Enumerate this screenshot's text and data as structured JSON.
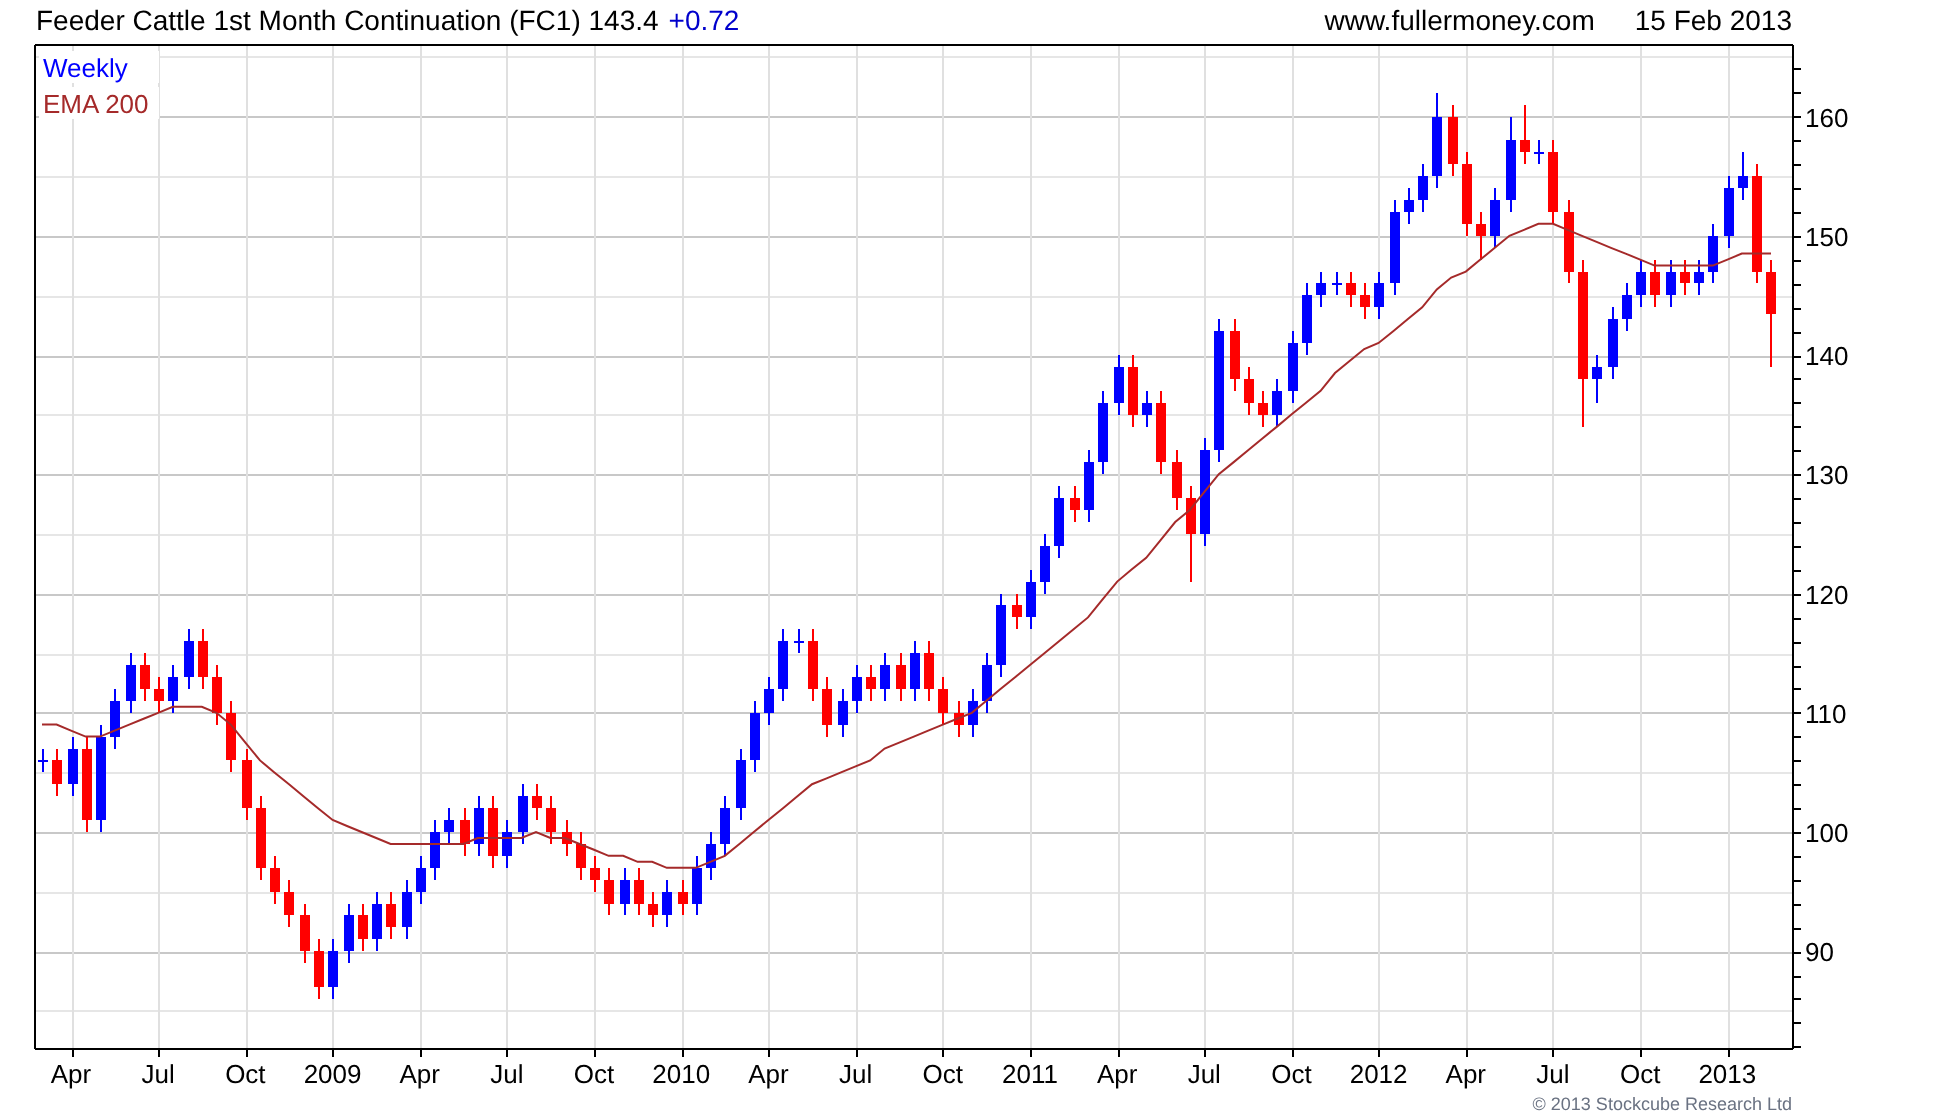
{
  "header": {
    "title": "Feeder Cattle 1st Month Continuation (FC1) 143.4",
    "change": "+0.72",
    "site": "www.fullermoney.com",
    "date": "15 Feb 2013"
  },
  "chart": {
    "legend": [
      {
        "label": "Weekly",
        "color": "#0000ff"
      }
    ],
    "chart_data": {
      "type": "candlestick",
      "grid": true,
      "categories": [
        null,
        null,
        "Apr",
        null,
        null,
        null,
        null,
        null,
        "Jul",
        null,
        null,
        null,
        null,
        null,
        "Oct",
        null,
        null,
        null,
        null,
        null,
        "2009",
        null,
        null,
        null,
        null,
        null,
        "Apr",
        null,
        null,
        null,
        null,
        null,
        "Jul",
        null,
        null,
        null,
        null,
        null,
        "Oct",
        null,
        null,
        null,
        null,
        null,
        "2010",
        null,
        null,
        null,
        null,
        null,
        "Apr",
        null,
        null,
        null,
        null,
        null,
        "Jul",
        null,
        null,
        null,
        null,
        null,
        "Oct",
        null,
        null,
        null,
        null,
        null,
        "2011",
        null,
        null,
        null,
        null,
        null,
        "Apr",
        null,
        null,
        null,
        null,
        null,
        "Jul",
        null,
        null,
        null,
        null,
        null,
        "Oct",
        null,
        null,
        null,
        null,
        null,
        "2012",
        null,
        null,
        null,
        null,
        null,
        "Apr",
        null,
        null,
        null,
        null,
        null,
        "Jul",
        null,
        null,
        null,
        null,
        null,
        "Oct",
        null,
        null,
        null,
        null,
        null,
        "2013",
        null,
        null,
        null
      ],
      "ohlc": [
        [
          106,
          107,
          105,
          106
        ],
        [
          106,
          107,
          103,
          104
        ],
        [
          104,
          108,
          103,
          107
        ],
        [
          107,
          108,
          100,
          101
        ],
        [
          101,
          109,
          100,
          108
        ],
        [
          108,
          112,
          107,
          111
        ],
        [
          111,
          115,
          110,
          114
        ],
        [
          114,
          115,
          111,
          112
        ],
        [
          112,
          113,
          110,
          111
        ],
        [
          111,
          114,
          110,
          113
        ],
        [
          113,
          117,
          112,
          116
        ],
        [
          116,
          117,
          112,
          113
        ],
        [
          113,
          114,
          109,
          110
        ],
        [
          110,
          111,
          105,
          106
        ],
        [
          106,
          107,
          101,
          102
        ],
        [
          102,
          103,
          96,
          97
        ],
        [
          97,
          98,
          94,
          95
        ],
        [
          95,
          96,
          92,
          93
        ],
        [
          93,
          94,
          89,
          90
        ],
        [
          90,
          91,
          86,
          87
        ],
        [
          87,
          91,
          86,
          90
        ],
        [
          90,
          94,
          89,
          93
        ],
        [
          93,
          94,
          90,
          91
        ],
        [
          91,
          95,
          90,
          94
        ],
        [
          94,
          95,
          91,
          92
        ],
        [
          92,
          96,
          91,
          95
        ],
        [
          95,
          98,
          94,
          97
        ],
        [
          97,
          101,
          96,
          100
        ],
        [
          100,
          102,
          99,
          101
        ],
        [
          101,
          102,
          98,
          99
        ],
        [
          99,
          103,
          98,
          102
        ],
        [
          102,
          103,
          97,
          98
        ],
        [
          98,
          101,
          97,
          100
        ],
        [
          100,
          104,
          99,
          103
        ],
        [
          103,
          104,
          101,
          102
        ],
        [
          102,
          103,
          99,
          100
        ],
        [
          100,
          101,
          98,
          99
        ],
        [
          99,
          100,
          96,
          97
        ],
        [
          97,
          98,
          95,
          96
        ],
        [
          96,
          97,
          93,
          94
        ],
        [
          94,
          97,
          93,
          96
        ],
        [
          96,
          97,
          93,
          94
        ],
        [
          94,
          95,
          92,
          93
        ],
        [
          93,
          96,
          92,
          95
        ],
        [
          95,
          96,
          93,
          94
        ],
        [
          94,
          98,
          93,
          97
        ],
        [
          97,
          100,
          96,
          99
        ],
        [
          99,
          103,
          98,
          102
        ],
        [
          102,
          107,
          101,
          106
        ],
        [
          106,
          111,
          105,
          110
        ],
        [
          110,
          113,
          109,
          112
        ],
        [
          112,
          117,
          111,
          116
        ],
        [
          116,
          117,
          115,
          116
        ],
        [
          116,
          117,
          111,
          112
        ],
        [
          112,
          113,
          108,
          109
        ],
        [
          109,
          112,
          108,
          111
        ],
        [
          111,
          114,
          110,
          113
        ],
        [
          113,
          114,
          111,
          112
        ],
        [
          112,
          115,
          111,
          114
        ],
        [
          114,
          115,
          111,
          112
        ],
        [
          112,
          116,
          111,
          115
        ],
        [
          115,
          116,
          111,
          112
        ],
        [
          112,
          113,
          109,
          110
        ],
        [
          110,
          111,
          108,
          109
        ],
        [
          109,
          112,
          108,
          111
        ],
        [
          111,
          115,
          110,
          114
        ],
        [
          114,
          120,
          113,
          119
        ],
        [
          119,
          120,
          117,
          118
        ],
        [
          118,
          122,
          117,
          121
        ],
        [
          121,
          125,
          120,
          124
        ],
        [
          124,
          129,
          123,
          128
        ],
        [
          128,
          129,
          126,
          127
        ],
        [
          127,
          132,
          126,
          131
        ],
        [
          131,
          137,
          130,
          136
        ],
        [
          136,
          140,
          135,
          139
        ],
        [
          139,
          140,
          134,
          135
        ],
        [
          135,
          137,
          134,
          136
        ],
        [
          136,
          137,
          130,
          131
        ],
        [
          131,
          132,
          127,
          128
        ],
        [
          128,
          129,
          121,
          125
        ],
        [
          125,
          133,
          124,
          132
        ],
        [
          132,
          143,
          131,
          142
        ],
        [
          142,
          143,
          137,
          138
        ],
        [
          138,
          139,
          135,
          136
        ],
        [
          136,
          137,
          134,
          135
        ],
        [
          135,
          138,
          134,
          137
        ],
        [
          137,
          142,
          136,
          141
        ],
        [
          141,
          146,
          140,
          145
        ],
        [
          145,
          147,
          144,
          146
        ],
        [
          146,
          147,
          145,
          146
        ],
        [
          146,
          147,
          144,
          145
        ],
        [
          145,
          146,
          143,
          144
        ],
        [
          144,
          147,
          143,
          146
        ],
        [
          146,
          153,
          145,
          152
        ],
        [
          152,
          154,
          151,
          153
        ],
        [
          153,
          156,
          152,
          155
        ],
        [
          155,
          162,
          154,
          160
        ],
        [
          160,
          161,
          155,
          156
        ],
        [
          156,
          157,
          150,
          151
        ],
        [
          151,
          152,
          148,
          150
        ],
        [
          150,
          154,
          149,
          153
        ],
        [
          153,
          160,
          152,
          158
        ],
        [
          158,
          161,
          156,
          157
        ],
        [
          157,
          158,
          156,
          157
        ],
        [
          157,
          158,
          151,
          152
        ],
        [
          152,
          153,
          146,
          147
        ],
        [
          147,
          148,
          134,
          138
        ],
        [
          138,
          140,
          136,
          139
        ],
        [
          139,
          144,
          138,
          143
        ],
        [
          143,
          146,
          142,
          145
        ],
        [
          145,
          148,
          144,
          147
        ],
        [
          147,
          148,
          144,
          145
        ],
        [
          145,
          148,
          144,
          147
        ],
        [
          147,
          148,
          145,
          146
        ],
        [
          146,
          148,
          145,
          147
        ],
        [
          147,
          151,
          146,
          150
        ],
        [
          150,
          155,
          149,
          154
        ],
        [
          154,
          157,
          153,
          155
        ],
        [
          155,
          156,
          146,
          147
        ],
        [
          147,
          148,
          139,
          143.4
        ]
      ],
      "series": [
        {
          "name": "EMA 200",
          "type": "line",
          "color": "#a52a2a",
          "values": [
            109,
            109,
            108.5,
            108,
            108,
            108.5,
            109,
            109.5,
            110,
            110.5,
            110.5,
            110.5,
            110,
            109,
            107.5,
            106,
            105,
            104,
            103,
            102,
            101,
            100.5,
            100,
            99.5,
            99,
            99,
            99,
            99,
            99,
            99,
            99.5,
            99.5,
            99.5,
            99.5,
            100,
            99.5,
            99.5,
            99,
            98.5,
            98,
            98,
            97.5,
            97.5,
            97,
            97,
            97,
            97.5,
            98,
            99,
            100,
            101,
            102,
            103,
            104,
            104.5,
            105,
            105.5,
            106,
            107,
            107.5,
            108,
            108.5,
            109,
            109.5,
            110,
            111,
            112,
            113,
            114,
            115,
            116,
            117,
            118,
            119.5,
            121,
            122,
            123,
            124.5,
            126,
            127,
            128.5,
            130,
            131,
            132,
            133,
            134,
            135,
            136,
            137,
            138.5,
            139.5,
            140.5,
            141,
            142,
            143,
            144,
            145.5,
            146.5,
            147,
            148,
            149,
            150,
            150.5,
            151,
            151,
            150.5,
            150,
            149.5,
            149,
            148.5,
            148,
            147.5,
            147.5,
            147.5,
            147.5,
            147.5,
            148,
            148.5,
            148.5,
            148.5
          ]
        }
      ],
      "ylim": [
        81.8,
        166
      ],
      "yticks": [
        90,
        100,
        110,
        120,
        130,
        140,
        150,
        160
      ]
    }
  },
  "footer": "© 2013 Stockcube Research Ltd"
}
